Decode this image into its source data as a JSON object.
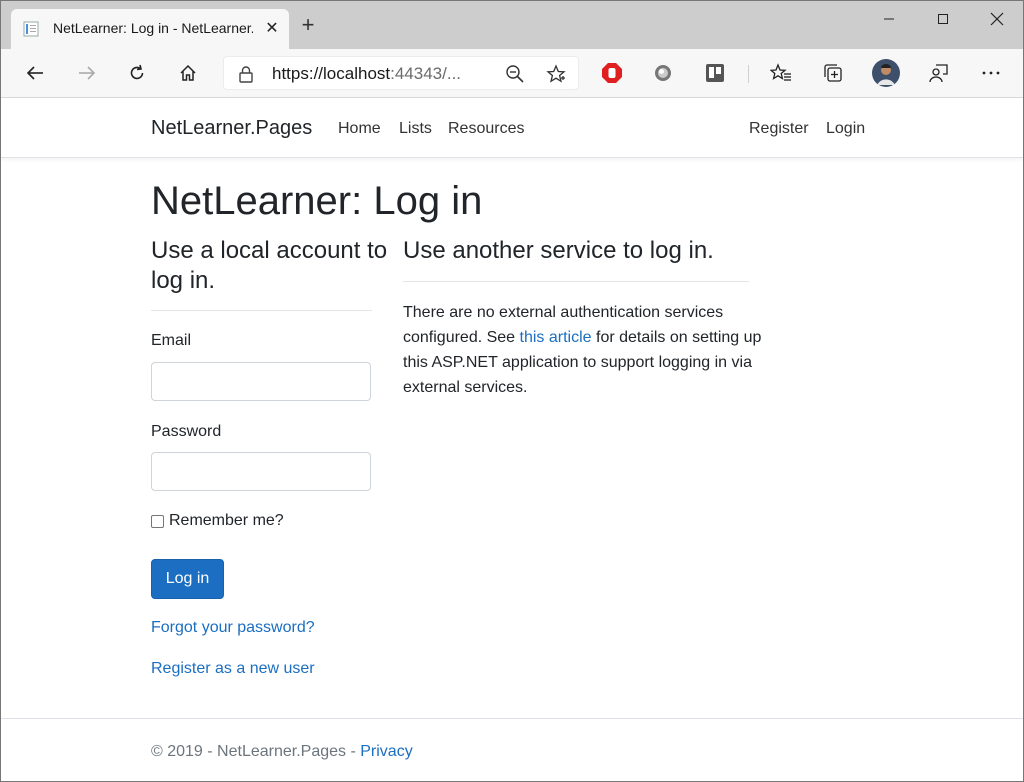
{
  "browser": {
    "tab_title": "NetLearner: Log in - NetLearner.P",
    "address_host": "https://localhost",
    "address_rest": ":44343/..."
  },
  "navbar": {
    "brand": "NetLearner.Pages",
    "links": [
      "Home",
      "Lists",
      "Resources"
    ],
    "right_links": [
      "Register",
      "Login"
    ]
  },
  "main": {
    "title": "NetLearner: Log in",
    "local": {
      "heading": "Use a local account to log in.",
      "email_label": "Email",
      "email_value": "",
      "password_label": "Password",
      "password_value": "",
      "remember_label": "Remember me?",
      "login_button": "Log in",
      "forgot_link": "Forgot your password?",
      "register_link": "Register as a new user"
    },
    "external": {
      "heading": "Use another service to log in.",
      "text_before": "There are no external authentication services configured. See ",
      "link_text": "this article",
      "text_after": " for details on setting up this ASP.NET application to support logging in via external services."
    }
  },
  "footer": {
    "text": "© 2019 - NetLearner.Pages - ",
    "privacy_link": "Privacy"
  },
  "icons": {
    "back": "back-arrow-icon",
    "forward": "forward-arrow-icon",
    "refresh": "refresh-icon",
    "home": "home-icon",
    "lock": "lock-icon",
    "zoom": "zoom-out-icon",
    "favorite": "star-icon",
    "adblock": "adblock-icon",
    "extension": "extension-icon",
    "trello": "trello-icon",
    "favorites": "favorites-icon",
    "collections": "collections-icon",
    "profile": "avatar",
    "feedback": "feedback-icon",
    "more": "more-icon"
  },
  "colors": {
    "link": "#1b6ec2",
    "primary_button": "#1b6ec2"
  }
}
